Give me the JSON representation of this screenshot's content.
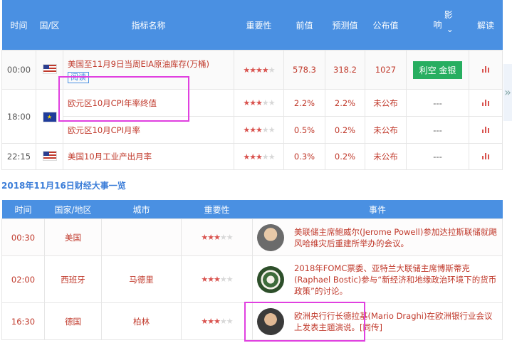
{
  "indicators": {
    "headers": {
      "time": "时间",
      "country": "国/区",
      "name": "指标名称",
      "importance": "重要性",
      "previous": "前值",
      "forecast": "预测值",
      "actual": "公布值",
      "impact": "影\n响",
      "impact_chevron": "⌄",
      "analysis": "解读"
    },
    "rows": [
      {
        "time": "00:00",
        "flag": "us-flag-icon",
        "name": "美国至11月9日当周EIA原油库存(万桶)",
        "read_label": "阅读",
        "stars": 4,
        "previous": "578.3",
        "forecast": "318.2",
        "actual": "1027",
        "impact": "利空 金银"
      },
      {
        "time": "18:00",
        "flag": "eu-flag-icon",
        "name": "欧元区10月CPI年率终值",
        "stars": 3,
        "previous": "2.2%",
        "forecast": "2.2%",
        "actual": "未公布",
        "impact": "---"
      },
      {
        "time": "",
        "flag": "",
        "name": "欧元区10月CPI月率",
        "stars": 3,
        "previous": "0.5%",
        "forecast": "0.2%",
        "actual": "未公布",
        "impact": "---"
      },
      {
        "time": "22:15",
        "flag": "us-flag-icon",
        "name": "美国10月工业产出月率",
        "stars": 3,
        "previous": "0.3%",
        "forecast": "0.2%",
        "actual": "未公布",
        "impact": "---"
      }
    ]
  },
  "pager_glyph": "»",
  "events_title": "2018年11月16日财经大事一览",
  "events": {
    "headers": {
      "time": "时间",
      "country": "国家/地区",
      "city": "城市",
      "importance": "重要性",
      "event": "事件"
    },
    "rows": [
      {
        "time": "00:30",
        "country": "美国",
        "city": "",
        "stars": 3,
        "avatar": "powell-avatar",
        "text": "美联储主席鲍威尔(Jerome Powell)参加达拉斯联储就飓风哈维灾后重建所举办的会议。"
      },
      {
        "time": "02:00",
        "country": "西班牙",
        "city": "马德里",
        "stars": 3,
        "avatar": "fed-seal-avatar",
        "text": "2018年FOMC票委、亚特兰大联储主席博斯蒂克(Raphael Bostic)参与“新经济和地缘政治环境下的货币政策”的讨论。"
      },
      {
        "time": "16:30",
        "country": "德国",
        "city": "柏林",
        "stars": 3,
        "avatar": "draghi-avatar",
        "text": "欧洲央行行长德拉基(Mario Draghi)在欧洲银行业会议上发表主题演说。[同传]"
      }
    ]
  },
  "colors": {
    "header_bg": "#4a90e2",
    "accent_red": "#c0392b",
    "impact_green": "#27ae60",
    "highlight": "#e040e0"
  }
}
